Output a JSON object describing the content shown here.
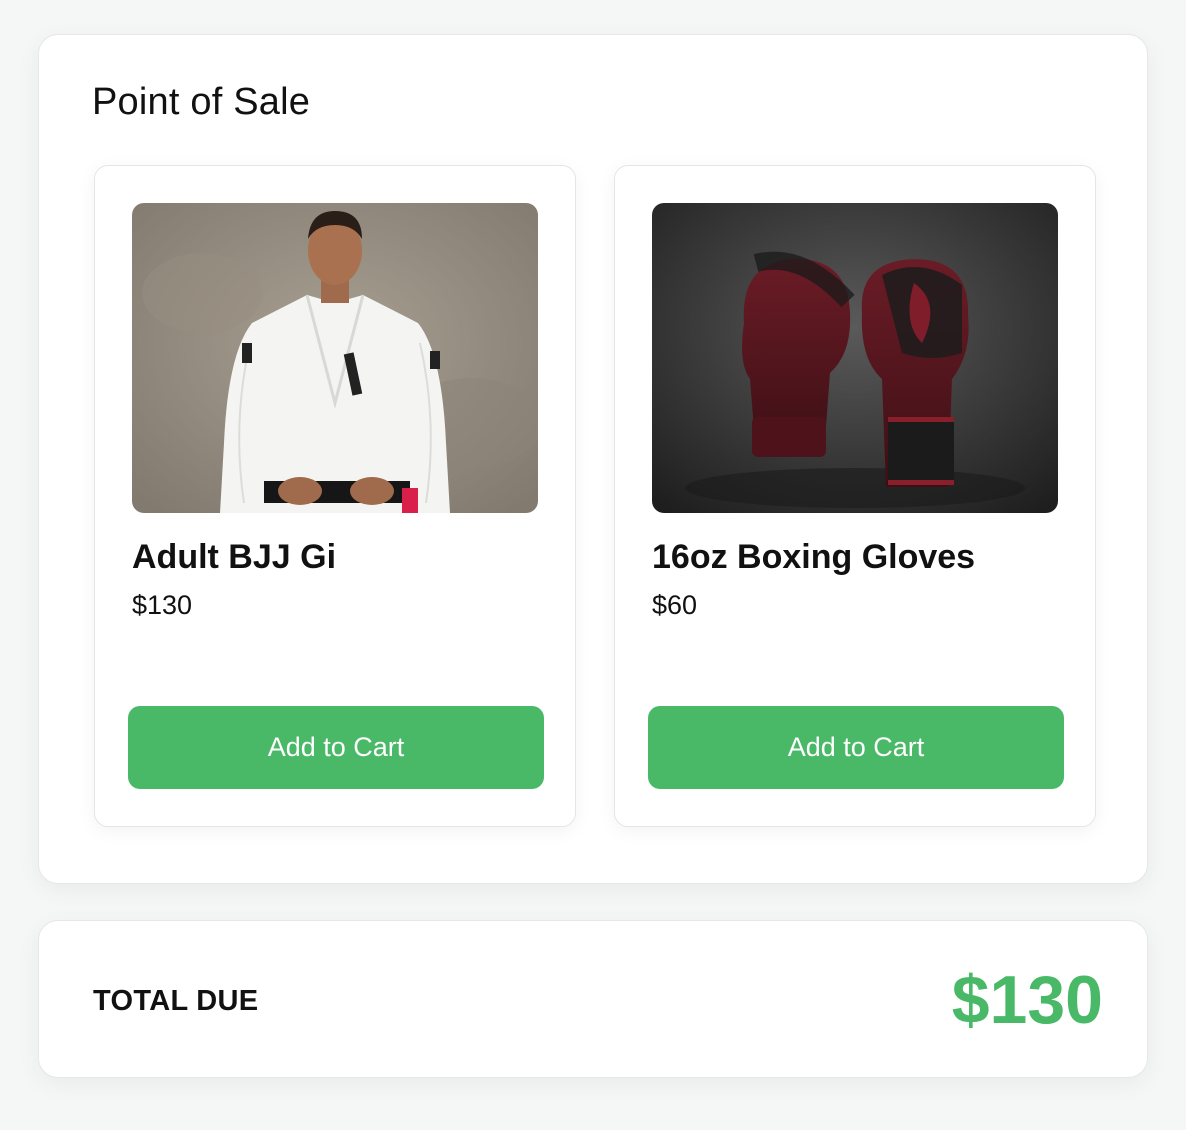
{
  "header": {
    "title": "Point of Sale"
  },
  "products": [
    {
      "name": "Adult BJJ Gi",
      "price": "$130",
      "button_label": "Add to Cart",
      "image": "gi-photo"
    },
    {
      "name": "16oz Boxing Gloves",
      "price": "$60",
      "button_label": "Add to Cart",
      "image": "boxing-gloves-photo"
    }
  ],
  "total": {
    "label": "TOTAL DUE",
    "value": "$130"
  },
  "colors": {
    "accent": "#49b968",
    "background": "#f5f6f6",
    "card": "#ffffff"
  }
}
